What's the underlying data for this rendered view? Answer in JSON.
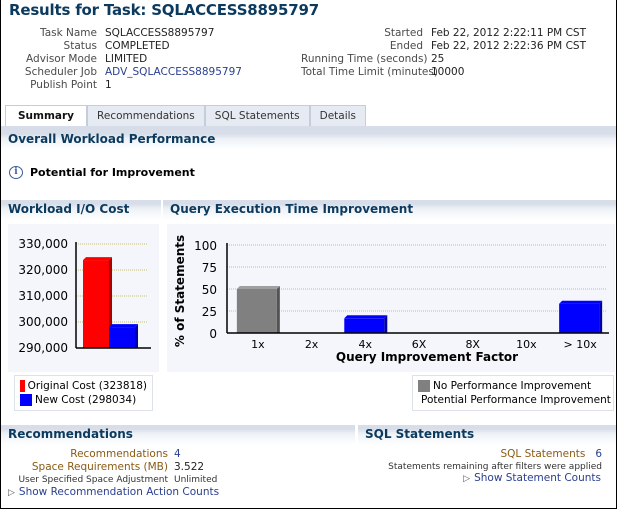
{
  "page": {
    "title": "Results for Task: SQLACCESS8895797"
  },
  "task_info": {
    "left": [
      {
        "label": "Task Name",
        "value": "SQLACCESS8895797",
        "link": false
      },
      {
        "label": "Status",
        "value": "COMPLETED",
        "link": false
      },
      {
        "label": "Advisor Mode",
        "value": "LIMITED",
        "link": false
      },
      {
        "label": "Scheduler Job",
        "value": "ADV_SQLACCESS8895797",
        "link": true
      },
      {
        "label": "Publish Point",
        "value": "1",
        "link": false
      }
    ],
    "right": [
      {
        "label": "Started",
        "value": "Feb 22, 2012 2:22:11 PM CST"
      },
      {
        "label": "Ended",
        "value": "Feb 22, 2012 2:22:36 PM CST"
      },
      {
        "label": "Running Time (seconds)",
        "value": "25"
      },
      {
        "label": "Total Time Limit (minutes)",
        "value": "10000"
      }
    ]
  },
  "tabs": [
    {
      "label": "Summary",
      "active": true
    },
    {
      "label": "Recommendations",
      "active": false
    },
    {
      "label": "SQL Statements",
      "active": false
    },
    {
      "label": "Details",
      "active": false
    }
  ],
  "overall": {
    "header": "Overall Workload Performance",
    "info_icon": "info-icon",
    "message": "Potential for Improvement"
  },
  "io_cost": {
    "header": "Workload I/O Cost",
    "legend": [
      {
        "label": "Original Cost (323818)",
        "color": "#ff0000"
      },
      {
        "label": "New Cost (298034)",
        "color": "#0000ff"
      }
    ]
  },
  "qeti": {
    "header": "Query Execution Time Improvement",
    "legend": [
      {
        "label": "No Performance Improvement",
        "color": "#808080"
      },
      {
        "label": "Potential Performance Improvement",
        "color": "#0000ff"
      }
    ]
  },
  "chart_data": [
    {
      "type": "bar",
      "title": "Workload I/O Cost",
      "categories": [
        "Original Cost",
        "New Cost"
      ],
      "values": [
        323818,
        298034
      ],
      "colors": [
        "#ff0000",
        "#0000ff"
      ],
      "ylim": [
        290000,
        330000
      ],
      "yticks": [
        290000,
        300000,
        310000,
        320000,
        330000
      ],
      "ytick_labels": [
        "290,000",
        "300,000",
        "310,000",
        "320,000",
        "330,000"
      ],
      "xlabel": "",
      "ylabel": "",
      "grid": true
    },
    {
      "type": "bar",
      "title": "Query Execution Time Improvement",
      "categories": [
        "1x",
        "2x",
        "4x",
        "6X",
        "8X",
        "10x",
        "> 10x"
      ],
      "series": [
        {
          "name": "No Performance Improvement",
          "color": "#808080",
          "values": [
            50,
            0,
            0,
            0,
            0,
            0,
            0
          ]
        },
        {
          "name": "Potential Performance Improvement",
          "color": "#0000ff",
          "values": [
            0,
            0,
            16.7,
            0,
            0,
            0,
            33.3
          ]
        }
      ],
      "ylim": [
        0,
        100
      ],
      "yticks": [
        0,
        25,
        50,
        75,
        100
      ],
      "xlabel": "Query Improvement Factor",
      "ylabel": "% of Statements",
      "grid": true,
      "legend": "bottom-right"
    }
  ],
  "recommendations": {
    "header": "Recommendations",
    "rows": [
      {
        "label": "Recommendations",
        "value": "4",
        "link": true
      },
      {
        "label": "Space Requirements (MB)",
        "value": "3.522",
        "link": false
      }
    ],
    "small_row": {
      "label": "User Specified Space Adjustment",
      "value": "Unlimited"
    },
    "disclose": "Show Recommendation Action Counts"
  },
  "sql_statements": {
    "header": "SQL Statements",
    "label": "SQL Statements",
    "value": "6",
    "note": "Statements remaining after filters were applied",
    "disclose": "Show Statement Counts"
  }
}
